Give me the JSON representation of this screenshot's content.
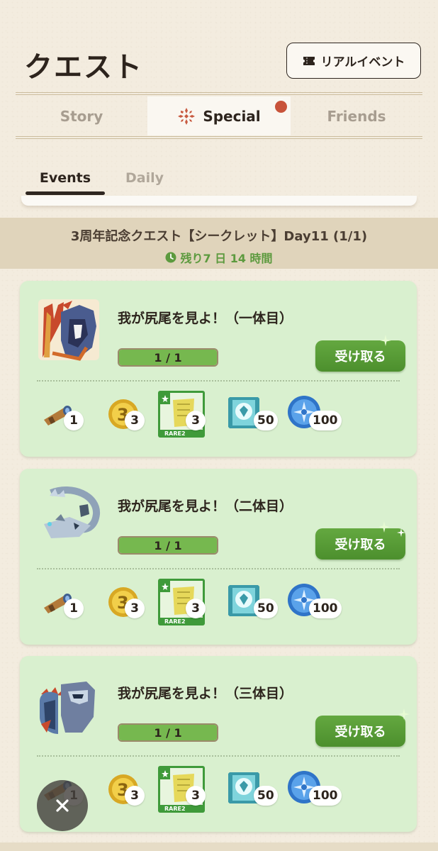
{
  "header": {
    "title": "クエスト",
    "real_event_label": "リアルイベント",
    "ticket_icon": "ticket-icon"
  },
  "tabs": [
    {
      "label": "Story",
      "active": false
    },
    {
      "label": "Special",
      "active": true,
      "icon": "special-emblem-icon",
      "notification": true
    },
    {
      "label": "Friends",
      "active": false
    }
  ],
  "sub_tabs": [
    {
      "label": "Events",
      "active": true
    },
    {
      "label": "Daily",
      "active": false
    }
  ],
  "event": {
    "title": "3周年記念クエスト【シークレット】Day11 (1/1)",
    "remaining": "残り7 日 14 時間"
  },
  "quests": [
    {
      "name": "我が尻尾を見よ！（一体目）",
      "monster_icon": "rathalos-icon",
      "progress_text": "1 / 1",
      "progress": 1.0,
      "claim_label": "受け取る",
      "rewards": [
        {
          "icon": "telescope-icon",
          "qty": "1"
        },
        {
          "icon": "zenny-coin-icon",
          "qty": "3"
        },
        {
          "icon": "rare-ticket-icon",
          "qty": "3",
          "badge": "RARE2"
        },
        {
          "icon": "crystal-icon",
          "qty": "50"
        },
        {
          "icon": "blue-orb-icon",
          "qty": "100"
        }
      ]
    },
    {
      "name": "我が尻尾を見よ！（二体目）",
      "monster_icon": "legiana-icon",
      "progress_text": "1 / 1",
      "progress": 1.0,
      "claim_label": "受け取る",
      "rewards": [
        {
          "icon": "telescope-icon",
          "qty": "1"
        },
        {
          "icon": "zenny-coin-icon",
          "qty": "3"
        },
        {
          "icon": "rare-ticket-icon",
          "qty": "3",
          "badge": "RARE2"
        },
        {
          "icon": "crystal-icon",
          "qty": "50"
        },
        {
          "icon": "blue-orb-icon",
          "qty": "100"
        }
      ]
    },
    {
      "name": "我が尻尾を見よ！（三体目）",
      "monster_icon": "zinogre-icon",
      "progress_text": "1 / 1",
      "progress": 1.0,
      "claim_label": "受け取る",
      "rewards": [
        {
          "icon": "telescope-icon",
          "qty": "1"
        },
        {
          "icon": "zenny-coin-icon",
          "qty": "3"
        },
        {
          "icon": "rare-ticket-icon",
          "qty": "3",
          "badge": "RARE2"
        },
        {
          "icon": "crystal-icon",
          "qty": "50"
        },
        {
          "icon": "blue-orb-icon",
          "qty": "100"
        }
      ]
    }
  ],
  "close_icon": "close-icon",
  "colors": {
    "accent_green": "#5c9a3e",
    "card_bg": "#d9f0cf",
    "notify_red": "#c8533a",
    "banner_bg": "#e0d4bb"
  }
}
